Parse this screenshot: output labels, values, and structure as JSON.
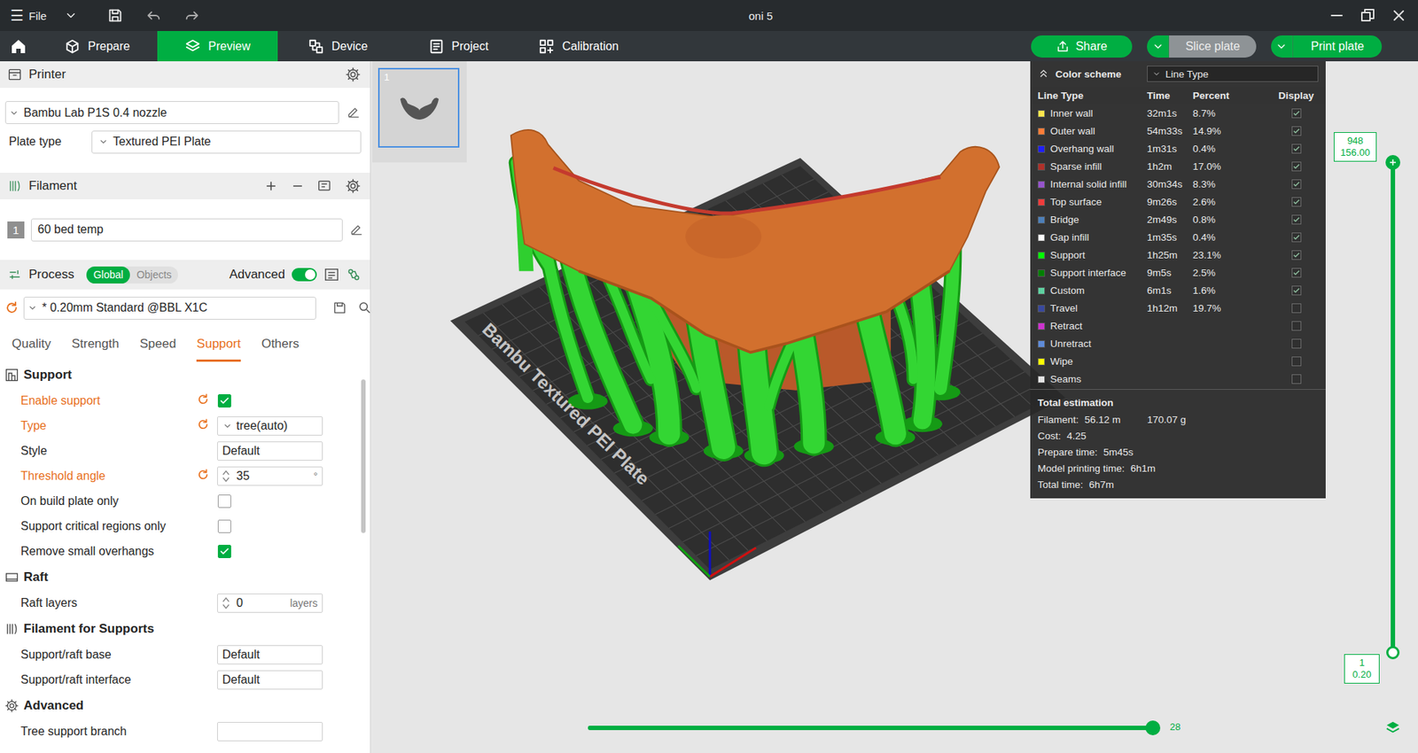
{
  "window": {
    "menu_icon": "☰",
    "menu": "File",
    "title": "oni 5"
  },
  "nav": {
    "tabs": [
      {
        "label": "Prepare",
        "selected": false
      },
      {
        "label": "Preview",
        "selected": true
      },
      {
        "label": "Device",
        "selected": false
      },
      {
        "label": "Project",
        "selected": false
      },
      {
        "label": "Calibration",
        "selected": false
      }
    ],
    "buttons": [
      {
        "label": "Share",
        "disabled": false,
        "menu": false
      },
      {
        "label": "Slice plate",
        "disabled": true,
        "menu": true
      },
      {
        "label": "Print plate",
        "disabled": false,
        "menu": true
      }
    ]
  },
  "printer": {
    "header": "Printer",
    "model": "Bambu Lab P1S 0.4 nozzle",
    "plate_type_label": "Plate type",
    "plate_type": "Textured PEI Plate"
  },
  "filament": {
    "header": "Filament",
    "items": [
      {
        "index": "1",
        "name": "60 bed temp"
      }
    ]
  },
  "process": {
    "header": "Process",
    "scope": [
      {
        "label": "Global",
        "selected": true
      },
      {
        "label": "Objects",
        "selected": false
      }
    ],
    "advanced_label": "Advanced",
    "advanced_on": true,
    "preset": "* 0.20mm Standard @BBL X1C",
    "preset_modified": true,
    "tabs": [
      {
        "label": "Quality",
        "selected": false
      },
      {
        "label": "Strength",
        "selected": false
      },
      {
        "label": "Speed",
        "selected": false
      },
      {
        "label": "Support",
        "selected": true
      },
      {
        "label": "Others",
        "selected": false
      }
    ]
  },
  "settings": [
    {
      "title": "Support",
      "rows": [
        {
          "label": "Enable support",
          "kind": "checkbox",
          "checked": true,
          "modified": true
        },
        {
          "label": "Type",
          "kind": "select",
          "value": "tree(auto)",
          "modified": true
        },
        {
          "label": "Style",
          "kind": "text",
          "value": "Default",
          "modified": false
        },
        {
          "label": "Threshold angle",
          "kind": "number",
          "value": "35",
          "unit": "°",
          "modified": true
        },
        {
          "label": "On build plate only",
          "kind": "checkbox",
          "checked": false,
          "modified": false
        },
        {
          "label": "Support critical regions only",
          "kind": "checkbox",
          "checked": false,
          "modified": false
        },
        {
          "label": "Remove small overhangs",
          "kind": "checkbox",
          "checked": true,
          "modified": false
        }
      ]
    },
    {
      "title": "Raft",
      "rows": [
        {
          "label": "Raft layers",
          "kind": "number",
          "value": "0",
          "unit": "layers",
          "modified": false
        }
      ]
    },
    {
      "title": "Filament for Supports",
      "rows": [
        {
          "label": "Support/raft base",
          "kind": "text",
          "value": "Default",
          "modified": false
        },
        {
          "label": "Support/raft interface",
          "kind": "text",
          "value": "Default",
          "modified": false
        }
      ]
    },
    {
      "title": "Advanced",
      "rows": [
        {
          "label": "Tree support branch",
          "kind": "partial",
          "modified": false
        }
      ]
    }
  ],
  "plates": [
    {
      "label": "1",
      "selected": true
    }
  ],
  "canvas": {
    "bed_label": "Bambu Textured PEI Plate"
  },
  "legend": {
    "title": "Color scheme",
    "scheme": "Line Type",
    "columns": [
      "Line Type",
      "Time",
      "Percent",
      "Display"
    ],
    "rows": [
      {
        "name": "Inner wall",
        "time": "32m1s",
        "percent": "8.7%",
        "color": "#ffe64d",
        "display": true
      },
      {
        "name": "Outer wall",
        "time": "54m33s",
        "percent": "14.9%",
        "color": "#ff7d38",
        "display": true
      },
      {
        "name": "Overhang wall",
        "time": "1m31s",
        "percent": "0.4%",
        "color": "#1f1fff",
        "display": true
      },
      {
        "name": "Sparse infill",
        "time": "1h2m",
        "percent": "17.0%",
        "color": "#b03029",
        "display": true
      },
      {
        "name": "Internal solid infill",
        "time": "30m34s",
        "percent": "8.3%",
        "color": "#9654cc",
        "display": true
      },
      {
        "name": "Top surface",
        "time": "9m26s",
        "percent": "2.6%",
        "color": "#f03c3c",
        "display": true
      },
      {
        "name": "Bridge",
        "time": "2m49s",
        "percent": "0.8%",
        "color": "#4d80ba",
        "display": true
      },
      {
        "name": "Gap infill",
        "time": "1m35s",
        "percent": "0.4%",
        "color": "#ffffff",
        "display": true
      },
      {
        "name": "Support",
        "time": "1h25m",
        "percent": "23.1%",
        "color": "#00ff00",
        "display": true
      },
      {
        "name": "Support interface",
        "time": "9m5s",
        "percent": "2.5%",
        "color": "#008000",
        "display": true
      },
      {
        "name": "Custom",
        "time": "6m1s",
        "percent": "1.6%",
        "color": "#5ed1a0",
        "display": true
      },
      {
        "name": "Travel",
        "time": "1h12m",
        "percent": "19.7%",
        "color": "#38489e",
        "display": false
      },
      {
        "name": "Retract",
        "color": "#ce33ce",
        "display": false
      },
      {
        "name": "Unretract",
        "color": "#5e8bd8",
        "display": false
      },
      {
        "name": "Wipe",
        "color": "#ffff00",
        "display": false
      },
      {
        "name": "Seams",
        "color": "#e6e6e6",
        "display": false
      }
    ],
    "total_title": "Total estimation",
    "totals": [
      {
        "label": "Filament:",
        "values": [
          "56.12 m",
          "170.07 g"
        ]
      },
      {
        "label": "Cost:",
        "values": [
          "4.25"
        ]
      },
      {
        "label": "Prepare time:",
        "values": [
          "5m45s"
        ]
      },
      {
        "label": "Model printing time:",
        "values": [
          "6h1m"
        ]
      },
      {
        "label": "Total time:",
        "values": [
          "6h7m"
        ]
      }
    ]
  },
  "sliders": {
    "layer_top": {
      "index": "948",
      "height": "156.00"
    },
    "layer_bottom": {
      "index": "1",
      "height": "0.20"
    },
    "layer_level": 1,
    "move_reading": "28",
    "move_level": 1
  }
}
